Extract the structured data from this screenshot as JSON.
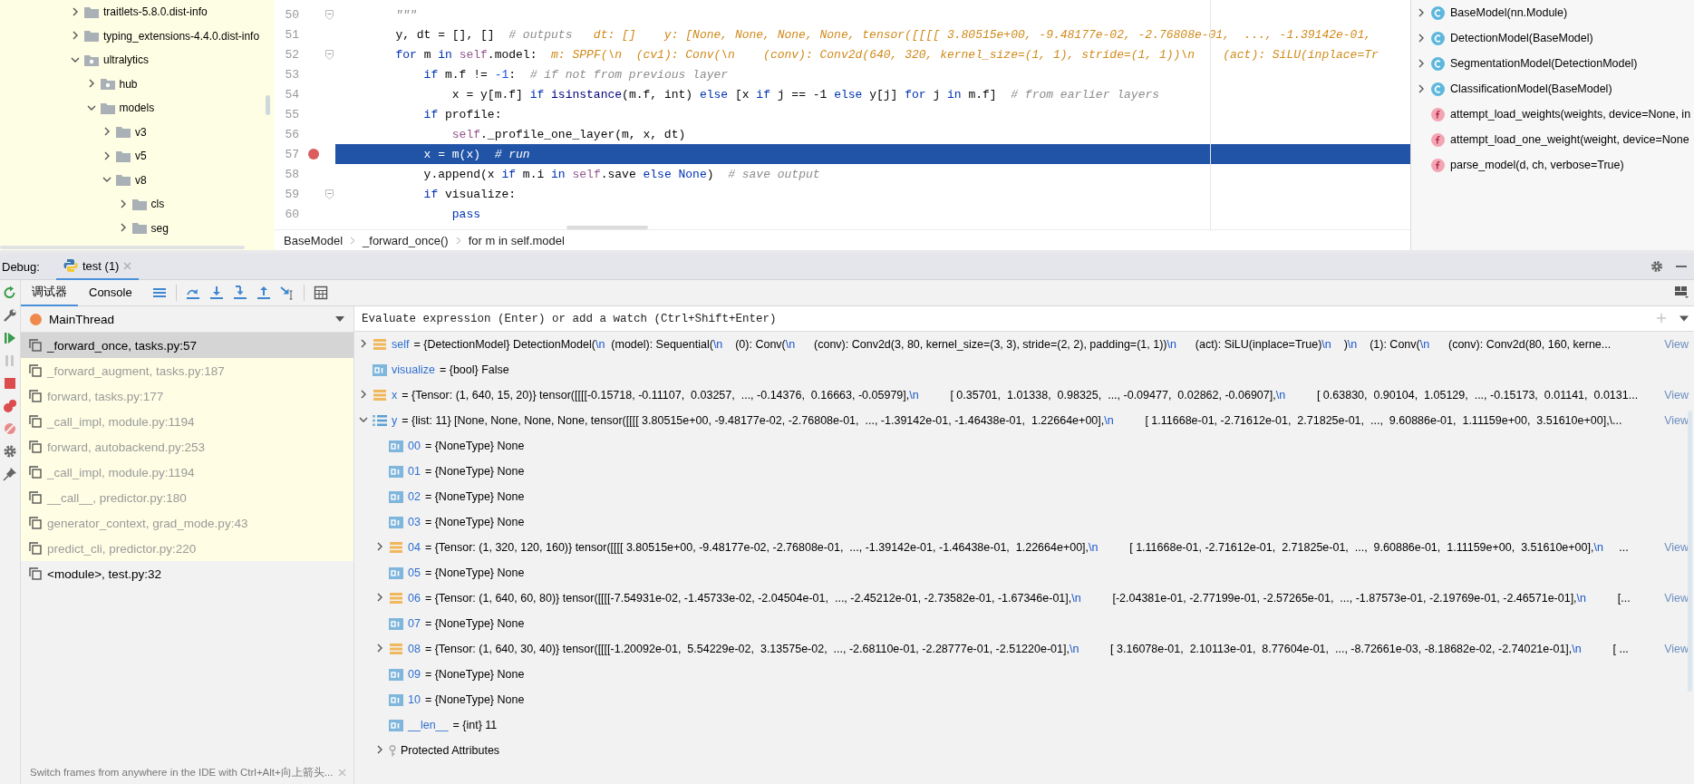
{
  "project_tree": {
    "items": [
      {
        "label": "traitlets-5.8.0.dist-info",
        "kind": "folder",
        "expanded": false
      },
      {
        "label": "typing_extensions-4.4.0.dist-info",
        "kind": "folder",
        "expanded": false
      },
      {
        "label": "ultralytics",
        "kind": "package",
        "expanded": true,
        "children": [
          {
            "label": "hub",
            "kind": "package",
            "expanded": false
          },
          {
            "label": "models",
            "kind": "folder",
            "expanded": true,
            "children": [
              {
                "label": "v3",
                "kind": "folder",
                "expanded": false
              },
              {
                "label": "v5",
                "kind": "folder",
                "expanded": false
              },
              {
                "label": "v8",
                "kind": "folder",
                "expanded": true,
                "children": [
                  {
                    "label": "cls",
                    "kind": "folder",
                    "expanded": false
                  },
                  {
                    "label": "seg",
                    "kind": "folder",
                    "expanded": false
                  }
                ]
              }
            ]
          }
        ]
      }
    ]
  },
  "editor": {
    "lines": [
      {
        "number": "50",
        "fold": true,
        "breakpoint": false,
        "current": false,
        "tokens": [
          {
            "kind": "doc",
            "text": "        \"\"\""
          }
        ]
      },
      {
        "number": "51",
        "fold": false,
        "breakpoint": false,
        "current": false,
        "tokens": [
          {
            "kind": "plain",
            "text": "        y, dt = [], []  "
          },
          {
            "kind": "comment",
            "text": "# outputs"
          },
          {
            "kind": "hint",
            "text": "   dt: []    y: [None, None, None, None, tensor([[[[ 3.80515e+00, -9.48177e-02, -2.76808e-01,  ..., -1.39142e-01,"
          }
        ]
      },
      {
        "number": "52",
        "fold": true,
        "breakpoint": false,
        "current": false,
        "tokens": [
          {
            "kind": "kw",
            "text": "        for"
          },
          {
            "kind": "plain",
            "text": " m "
          },
          {
            "kind": "kw",
            "text": "in"
          },
          {
            "kind": "self",
            "text": " self"
          },
          {
            "kind": "plain",
            "text": ".model:"
          },
          {
            "kind": "hint",
            "text": "  m: SPPF(\\n  (cv1): Conv(\\n    (conv): Conv2d(640, 320, kernel_size=(1, 1), stride=(1, 1))\\n    (act): SiLU(inplace=Tr"
          }
        ]
      },
      {
        "number": "53",
        "fold": false,
        "breakpoint": false,
        "current": false,
        "tokens": [
          {
            "kind": "kw",
            "text": "            if"
          },
          {
            "kind": "plain",
            "text": " m.f != "
          },
          {
            "kind": "num",
            "text": "-1"
          },
          {
            "kind": "plain",
            "text": ":  "
          },
          {
            "kind": "comment",
            "text": "# if not from previous layer"
          }
        ]
      },
      {
        "number": "54",
        "fold": false,
        "breakpoint": false,
        "current": false,
        "tokens": [
          {
            "kind": "plain",
            "text": "                x = y[m.f] "
          },
          {
            "kind": "kw",
            "text": "if"
          },
          {
            "kind": "builtin",
            "text": " isinstance"
          },
          {
            "kind": "plain",
            "text": "(m.f, int) "
          },
          {
            "kind": "kw",
            "text": "else"
          },
          {
            "kind": "plain",
            "text": " [x "
          },
          {
            "kind": "kw",
            "text": "if"
          },
          {
            "kind": "plain",
            "text": " j == -1 "
          },
          {
            "kind": "kw",
            "text": "else"
          },
          {
            "kind": "plain",
            "text": " y[j] "
          },
          {
            "kind": "kw",
            "text": "for"
          },
          {
            "kind": "plain",
            "text": " j "
          },
          {
            "kind": "kw",
            "text": "in"
          },
          {
            "kind": "plain",
            "text": " m.f]  "
          },
          {
            "kind": "comment",
            "text": "# from earlier layers"
          }
        ]
      },
      {
        "number": "55",
        "fold": false,
        "breakpoint": false,
        "current": false,
        "tokens": [
          {
            "kind": "kw",
            "text": "            if"
          },
          {
            "kind": "plain",
            "text": " profile:"
          }
        ]
      },
      {
        "number": "56",
        "fold": false,
        "breakpoint": false,
        "current": false,
        "tokens": [
          {
            "kind": "self",
            "text": "                self"
          },
          {
            "kind": "plain",
            "text": "._profile_one_layer(m, x, dt)"
          }
        ]
      },
      {
        "number": "57",
        "fold": false,
        "breakpoint": true,
        "current": true,
        "tokens": [
          {
            "kind": "plain",
            "text": "            x = m(x)  "
          },
          {
            "kind": "comment",
            "text": "# run"
          }
        ]
      },
      {
        "number": "58",
        "fold": false,
        "breakpoint": false,
        "current": false,
        "tokens": [
          {
            "kind": "plain",
            "text": "            y.append(x "
          },
          {
            "kind": "kw",
            "text": "if"
          },
          {
            "kind": "plain",
            "text": " m.i "
          },
          {
            "kind": "kw",
            "text": "in"
          },
          {
            "kind": "self",
            "text": " self"
          },
          {
            "kind": "plain",
            "text": ".save "
          },
          {
            "kind": "kw",
            "text": "else"
          },
          {
            "kind": "kw",
            "text": " None"
          },
          {
            "kind": "plain",
            "text": ")  "
          },
          {
            "kind": "comment",
            "text": "# save output"
          }
        ]
      },
      {
        "number": "59",
        "fold": true,
        "breakpoint": false,
        "current": false,
        "tokens": [
          {
            "kind": "kw",
            "text": "            if"
          },
          {
            "kind": "plain",
            "text": " visualize:"
          }
        ]
      },
      {
        "number": "60",
        "fold": false,
        "breakpoint": false,
        "current": false,
        "tokens": [
          {
            "kind": "kw",
            "text": "                pass"
          }
        ]
      }
    ],
    "breadcrumbs": [
      "BaseModel",
      "_forward_once()",
      "for m in self.model"
    ]
  },
  "structure": {
    "items": [
      {
        "kind": "class",
        "label": "BaseModel(nn.Module)",
        "expanded": false
      },
      {
        "kind": "class",
        "label": "DetectionModel(BaseModel)",
        "expanded": false
      },
      {
        "kind": "class",
        "label": "SegmentationModel(DetectionModel)",
        "expanded": false
      },
      {
        "kind": "class",
        "label": "ClassificationModel(BaseModel)",
        "expanded": false
      },
      {
        "kind": "function",
        "label": "attempt_load_weights(weights, device=None, in"
      },
      {
        "kind": "function",
        "label": "attempt_load_one_weight(weight, device=None"
      },
      {
        "kind": "function",
        "label": "parse_model(d, ch, verbose=True)"
      }
    ]
  },
  "debug": {
    "label": "Debug:",
    "session": "test (1)",
    "tabs": [
      {
        "label": "调试器",
        "selected": true
      },
      {
        "label": "Console",
        "selected": false
      }
    ],
    "thread": "MainThread",
    "frames": [
      {
        "label": "_forward_once, tasks.py:57",
        "selected": true,
        "library": false
      },
      {
        "label": "_forward_augment, tasks.py:187",
        "selected": false,
        "library": true
      },
      {
        "label": "forward, tasks.py:177",
        "selected": false,
        "library": true
      },
      {
        "label": "_call_impl, module.py:1194",
        "selected": false,
        "library": true
      },
      {
        "label": "forward, autobackend.py:253",
        "selected": false,
        "library": true
      },
      {
        "label": "_call_impl, module.py:1194",
        "selected": false,
        "library": true
      },
      {
        "label": "__call__, predictor.py:180",
        "selected": false,
        "library": true
      },
      {
        "label": "generator_context, grad_mode.py:43",
        "selected": false,
        "library": true
      },
      {
        "label": "predict_cli, predictor.py:220",
        "selected": false,
        "library": true
      },
      {
        "label": "<module>, test.py:32",
        "selected": false,
        "library": false
      }
    ],
    "hint": "Switch frames from anywhere in the IDE with Ctrl+Alt+向上箭头...",
    "evaluate": {
      "placeholder": "Evaluate expression (Enter) or add a watch (Ctrl+Shift+Enter)"
    },
    "variables": [
      {
        "name": "self",
        "kind": "object",
        "expanded": false,
        "value": "= {DetectionModel} DetectionModel(\\n  (model): Sequential(\\n    (0): Conv(\\n      (conv): Conv2d(3, 80, kernel_size=(3, 3), stride=(2, 2), padding=(1, 1))\\n      (act): SiLU(inplace=True)\\n    )\\n    (1): Conv(\\n      (conv): Conv2d(80, 160, kerne...",
        "link": "View"
      },
      {
        "name": "visualize",
        "kind": "primitive",
        "value": "= {bool} False"
      },
      {
        "name": "x",
        "kind": "object",
        "expanded": false,
        "value": "= {Tensor: (1, 640, 15, 20)} tensor([[[[-0.15718, -0.11107,  0.03257,  ..., -0.14376,  0.16663, -0.05979],\\n          [ 0.35701,  1.01338,  0.98325,  ..., -0.09477,  0.02862, -0.06907],\\n          [ 0.63830,  0.90104,  1.05129,  ..., -0.15173,  0.01141,  0.0131...",
        "link": "View"
      },
      {
        "name": "y",
        "kind": "list",
        "expanded": true,
        "value": "= {list: 11} [None, None, None, None, tensor([[[[ 3.80515e+00, -9.48177e-02, -2.76808e-01,  ..., -1.39142e-01, -1.46438e-01,  1.22664e+00],\\n          [ 1.11668e-01, -2.71612e-01,  2.71825e-01,  ...,  9.60886e-01,  1.11159e+00,  3.51610e+00],\\...",
        "link": "View",
        "children": [
          {
            "name": "00",
            "kind": "primitive",
            "value": "= {NoneType} None"
          },
          {
            "name": "01",
            "kind": "primitive",
            "value": "= {NoneType} None"
          },
          {
            "name": "02",
            "kind": "primitive",
            "value": "= {NoneType} None"
          },
          {
            "name": "03",
            "kind": "primitive",
            "value": "= {NoneType} None"
          },
          {
            "name": "04",
            "kind": "object",
            "expanded": false,
            "value": "= {Tensor: (1, 320, 120, 160)} tensor([[[[ 3.80515e+00, -9.48177e-02, -2.76808e-01,  ..., -1.39142e-01, -1.46438e-01,  1.22664e+00],\\n          [ 1.11668e-01, -2.71612e-01,  2.71825e-01,  ...,  9.60886e-01,  1.11159e+00,  3.51610e+00],\\n     ...",
            "link": "View"
          },
          {
            "name": "05",
            "kind": "primitive",
            "value": "= {NoneType} None"
          },
          {
            "name": "06",
            "kind": "object",
            "expanded": false,
            "value": "= {Tensor: (1, 640, 60, 80)} tensor([[[[-7.54931e-02, -1.45733e-02, -2.04504e-01,  ..., -2.45212e-01, -2.73582e-01, -1.67346e-01],\\n          [-2.04381e-01, -2.77199e-01, -2.57265e-01,  ..., -1.87573e-01, -2.19769e-01, -2.46571e-01],\\n          [...",
            "link": "View"
          },
          {
            "name": "07",
            "kind": "primitive",
            "value": "= {NoneType} None"
          },
          {
            "name": "08",
            "kind": "object",
            "expanded": false,
            "value": "= {Tensor: (1, 640, 30, 40)} tensor([[[[-1.20092e-01,  5.54229e-02,  3.13575e-02,  ..., -2.68110e-01, -2.28777e-01, -2.51220e-01],\\n          [ 3.16078e-01,  2.10113e-01,  8.77604e-01,  ..., -8.72661e-03, -8.18682e-02, -2.74021e-01],\\n          [ ...",
            "link": "View"
          },
          {
            "name": "09",
            "kind": "primitive",
            "value": "= {NoneType} None"
          },
          {
            "name": "10",
            "kind": "primitive",
            "value": "= {NoneType} None"
          },
          {
            "name": "__len__",
            "kind": "primitive",
            "value": "= {int} 11"
          },
          {
            "name": "Protected Attributes",
            "kind": "protected",
            "expanded": false
          }
        ]
      }
    ]
  }
}
